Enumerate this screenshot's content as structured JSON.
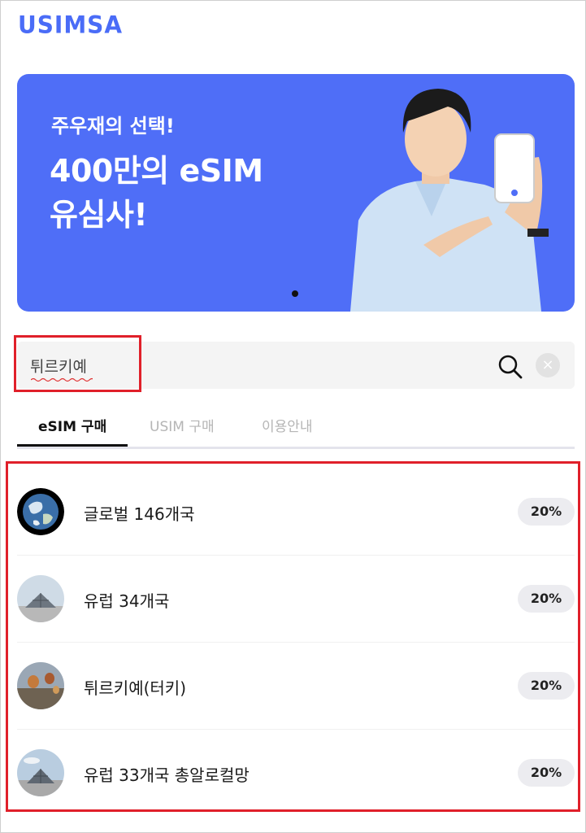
{
  "brand": {
    "logo": "USIMSA",
    "color": "#4a6cf7"
  },
  "banner": {
    "subtitle": "주우재의 선택!",
    "headline_line1": "400만의 eSIM",
    "headline_line2": "유심사!",
    "bg_color": "#4f6ef7"
  },
  "search": {
    "value": "튀르키예",
    "search_icon": "search-icon",
    "clear_icon": "clear-icon"
  },
  "tabs": [
    {
      "label": "eSIM 구매",
      "active": true
    },
    {
      "label": "USIM 구매",
      "active": false
    },
    {
      "label": "이용안내",
      "active": false
    }
  ],
  "results": [
    {
      "name": "글로벌 146개국",
      "discount": "20%",
      "image": "earth-globe"
    },
    {
      "name": "유럽 34개국",
      "discount": "20%",
      "image": "louvre-pyramid"
    },
    {
      "name": "튀르키예(터키)",
      "discount": "20%",
      "image": "cappadocia-balloons"
    },
    {
      "name": "유럽 33개국 총알로컬망",
      "discount": "20%",
      "image": "louvre-pyramid"
    }
  ],
  "annotation_color": "#e0202a"
}
